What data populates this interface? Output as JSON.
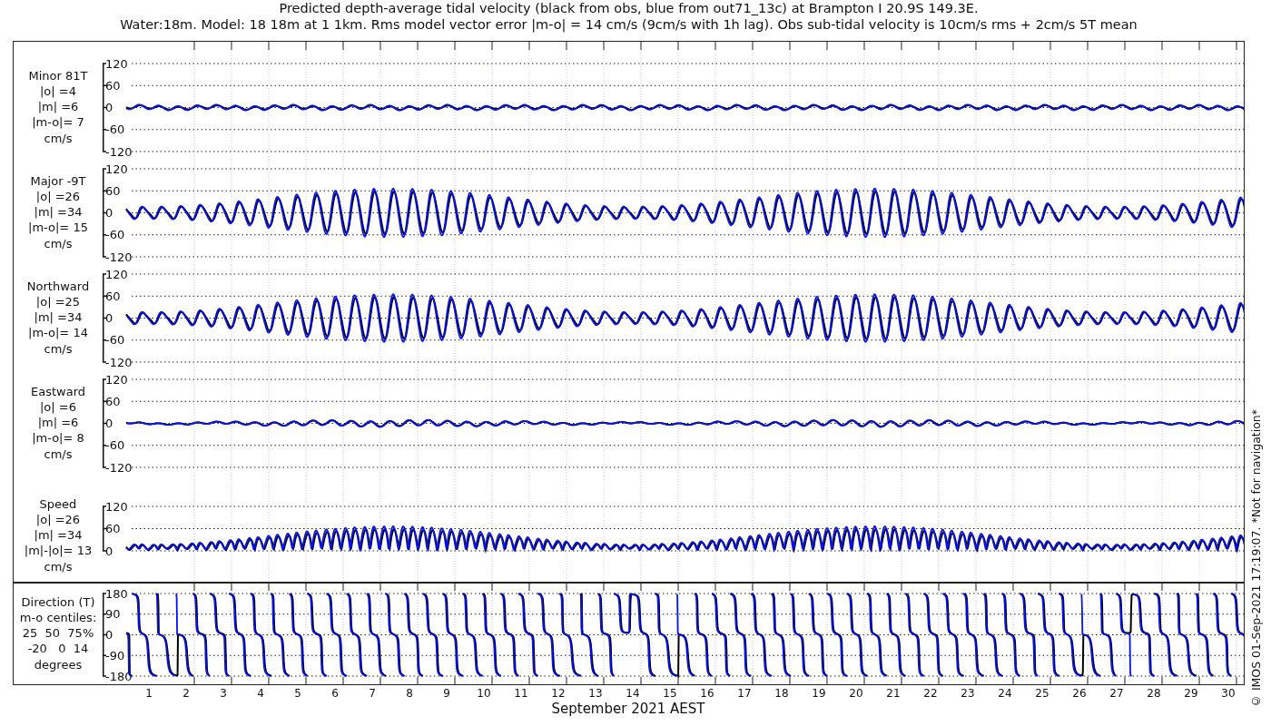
{
  "title": "Predicted depth-average tidal velocity (black from obs, blue from out71_13c) at Brampton I 20.9S 149.3E.",
  "subtitle": "Water:18m. Model: 18 18m at 1 1km. Rms model vector error |m-o| = 14 cm/s (9cm/s with 1h lag). Obs sub-tidal velocity is 10cm/s rms + 2cm/s 5T mean",
  "panels": [
    {
      "kind": "minor",
      "label_lines": [
        "Minor 81T",
        "|o| =4",
        "|m| =6",
        "|m-o|= 7",
        "cm/s"
      ],
      "y_tick_labels": [
        "120",
        "60",
        "0",
        "-60",
        "-120"
      ]
    },
    {
      "kind": "major",
      "label_lines": [
        "Major -9T",
        "|o| =26",
        "|m| =34",
        "|m-o|= 15",
        "cm/s"
      ],
      "y_tick_labels": [
        "120",
        "60",
        "0",
        "-60",
        "-120"
      ]
    },
    {
      "kind": "northward",
      "label_lines": [
        "Northward",
        "|o| =25",
        "|m| =34",
        "|m-o|= 14",
        "cm/s"
      ],
      "y_tick_labels": [
        "120",
        "60",
        "0",
        "-60",
        "-120"
      ]
    },
    {
      "kind": "eastward",
      "label_lines": [
        "Eastward",
        "|o| =6",
        "|m| =6",
        "|m-o|= 8",
        "cm/s"
      ],
      "y_tick_labels": [
        "120",
        "60",
        "0",
        "-60",
        "-120"
      ]
    },
    {
      "kind": "speed",
      "label_lines": [
        "Speed",
        "|o| =26",
        "|m| =34",
        "|m|-|o|= 13",
        "cm/s"
      ],
      "y_tick_labels": [
        "120",
        "60",
        "0"
      ]
    },
    {
      "kind": "direction",
      "label_lines": [
        "Direction (T)",
        "m-o centiles:",
        "25  50  75%",
        "-20   0  14",
        "degrees"
      ],
      "y_tick_labels": [
        "180",
        "90",
        "0",
        "-90",
        "-180"
      ]
    }
  ],
  "day_labels": [
    "1",
    "2",
    "3",
    "4",
    "5",
    "6",
    "7",
    "8",
    "9",
    "10",
    "11",
    "12",
    "13",
    "14",
    "15",
    "16",
    "17",
    "18",
    "19",
    "20",
    "21",
    "22",
    "23",
    "24",
    "25",
    "26",
    "27",
    "28",
    "29",
    "30"
  ],
  "x_axis_title": "September 2021 AEST",
  "credit": "© IMOS 01-Sep-2021 17:19:07. *Not for navigation*"
}
